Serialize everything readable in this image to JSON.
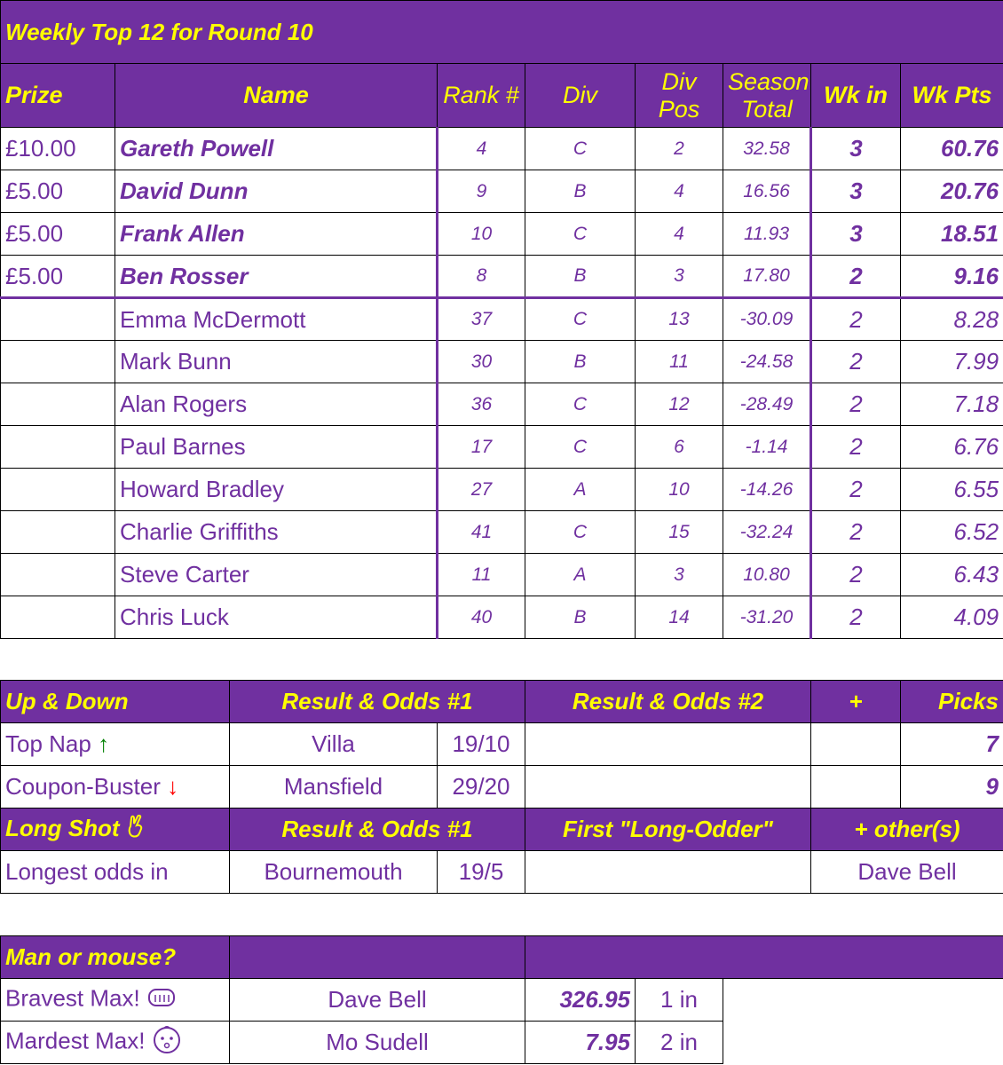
{
  "top12": {
    "title": "Weekly Top 12 for Round 10",
    "headers": {
      "prize": "Prize",
      "name": "Name",
      "rank": "Rank #",
      "div": "Div",
      "div_pos_1": "Div",
      "div_pos_2": "Pos",
      "season_1": "Season",
      "season_2": "Total",
      "wk_in": "Wk in",
      "wk_pts": "Wk Pts"
    },
    "rows": [
      {
        "prize": "£10.00",
        "name": "Gareth Powell",
        "rank": "4",
        "div": "C",
        "divpos": "2",
        "season": "32.58",
        "wkin": "3",
        "wkpts": "60.76"
      },
      {
        "prize": "£5.00",
        "name": "David Dunn",
        "rank": "9",
        "div": "B",
        "divpos": "4",
        "season": "16.56",
        "wkin": "3",
        "wkpts": "20.76"
      },
      {
        "prize": "£5.00",
        "name": "Frank Allen",
        "rank": "10",
        "div": "C",
        "divpos": "4",
        "season": "11.93",
        "wkin": "3",
        "wkpts": "18.51"
      },
      {
        "prize": "£5.00",
        "name": "Ben Rosser",
        "rank": "8",
        "div": "B",
        "divpos": "3",
        "season": "17.80",
        "wkin": "2",
        "wkpts": "9.16"
      },
      {
        "prize": "",
        "name": "Emma McDermott",
        "rank": "37",
        "div": "C",
        "divpos": "13",
        "season": "-30.09",
        "wkin": "2",
        "wkpts": "8.28"
      },
      {
        "prize": "",
        "name": "Mark Bunn",
        "rank": "30",
        "div": "B",
        "divpos": "11",
        "season": "-24.58",
        "wkin": "2",
        "wkpts": "7.99"
      },
      {
        "prize": "",
        "name": "Alan Rogers",
        "rank": "36",
        "div": "C",
        "divpos": "12",
        "season": "-28.49",
        "wkin": "2",
        "wkpts": "7.18"
      },
      {
        "prize": "",
        "name": "Paul Barnes",
        "rank": "17",
        "div": "C",
        "divpos": "6",
        "season": "-1.14",
        "wkin": "2",
        "wkpts": "6.76"
      },
      {
        "prize": "",
        "name": "Howard Bradley",
        "rank": "27",
        "div": "A",
        "divpos": "10",
        "season": "-14.26",
        "wkin": "2",
        "wkpts": "6.55"
      },
      {
        "prize": "",
        "name": "Charlie Griffiths",
        "rank": "41",
        "div": "C",
        "divpos": "15",
        "season": "-32.24",
        "wkin": "2",
        "wkpts": "6.52"
      },
      {
        "prize": "",
        "name": "Steve Carter",
        "rank": "11",
        "div": "A",
        "divpos": "3",
        "season": "10.80",
        "wkin": "2",
        "wkpts": "6.43"
      },
      {
        "prize": "",
        "name": "Chris Luck",
        "rank": "40",
        "div": "B",
        "divpos": "14",
        "season": "-31.20",
        "wkin": "2",
        "wkpts": "4.09"
      }
    ]
  },
  "updown": {
    "header": {
      "label": "Up & Down",
      "res1": "Result & Odds #1",
      "res2": "Result & Odds #2",
      "plus": "+",
      "picks": "Picks"
    },
    "top_nap": {
      "label": "Top Nap",
      "arrow": "↑",
      "team": "Villa",
      "odds": "19/10",
      "picks": "7"
    },
    "coupon_buster": {
      "label": "Coupon-Buster",
      "arrow": "↓",
      "team": "Mansfield",
      "odds": "29/20",
      "picks": "9"
    },
    "longshot_header": {
      "label": "Long Shot",
      "res1": "Result & Odds #1",
      "first": "First \"Long-Odder\"",
      "others": "+ other(s)"
    },
    "longest": {
      "label": "Longest odds in",
      "team": "Bournemouth",
      "odds": "19/5",
      "others": "Dave Bell"
    }
  },
  "manmouse": {
    "title": "Man or mouse?",
    "bravest": {
      "label": "Bravest Max!",
      "name": "Dave Bell",
      "value": "326.95",
      "in": "1 in"
    },
    "mardest": {
      "label": "Mardest Max!",
      "name": "Mo Sudell",
      "value": "7.95",
      "in": "2 in"
    }
  },
  "icons": {
    "up": "up-arrow-icon",
    "down": "down-arrow-icon",
    "crossed_fingers": "crossed-fingers-icon",
    "fist": "fist-icon",
    "baby": "baby-face-icon"
  },
  "colors": {
    "purple": "#7030a0",
    "yellow": "#ffff00",
    "green": "#008000",
    "red": "#ff0000"
  }
}
